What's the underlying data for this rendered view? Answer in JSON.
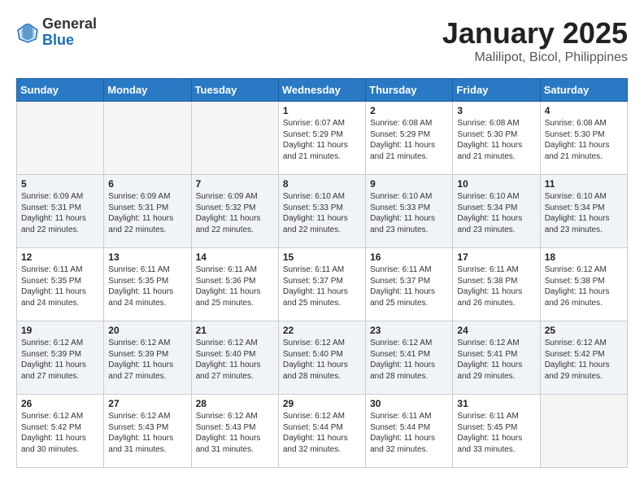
{
  "logo": {
    "general": "General",
    "blue": "Blue"
  },
  "header": {
    "title": "January 2025",
    "subtitle": "Malilipot, Bicol, Philippines"
  },
  "weekdays": [
    "Sunday",
    "Monday",
    "Tuesday",
    "Wednesday",
    "Thursday",
    "Friday",
    "Saturday"
  ],
  "weeks": [
    [
      {
        "day": "",
        "info": ""
      },
      {
        "day": "",
        "info": ""
      },
      {
        "day": "",
        "info": ""
      },
      {
        "day": "1",
        "info": "Sunrise: 6:07 AM\nSunset: 5:29 PM\nDaylight: 11 hours\nand 21 minutes."
      },
      {
        "day": "2",
        "info": "Sunrise: 6:08 AM\nSunset: 5:29 PM\nDaylight: 11 hours\nand 21 minutes."
      },
      {
        "day": "3",
        "info": "Sunrise: 6:08 AM\nSunset: 5:30 PM\nDaylight: 11 hours\nand 21 minutes."
      },
      {
        "day": "4",
        "info": "Sunrise: 6:08 AM\nSunset: 5:30 PM\nDaylight: 11 hours\nand 21 minutes."
      }
    ],
    [
      {
        "day": "5",
        "info": "Sunrise: 6:09 AM\nSunset: 5:31 PM\nDaylight: 11 hours\nand 22 minutes."
      },
      {
        "day": "6",
        "info": "Sunrise: 6:09 AM\nSunset: 5:31 PM\nDaylight: 11 hours\nand 22 minutes."
      },
      {
        "day": "7",
        "info": "Sunrise: 6:09 AM\nSunset: 5:32 PM\nDaylight: 11 hours\nand 22 minutes."
      },
      {
        "day": "8",
        "info": "Sunrise: 6:10 AM\nSunset: 5:33 PM\nDaylight: 11 hours\nand 22 minutes."
      },
      {
        "day": "9",
        "info": "Sunrise: 6:10 AM\nSunset: 5:33 PM\nDaylight: 11 hours\nand 23 minutes."
      },
      {
        "day": "10",
        "info": "Sunrise: 6:10 AM\nSunset: 5:34 PM\nDaylight: 11 hours\nand 23 minutes."
      },
      {
        "day": "11",
        "info": "Sunrise: 6:10 AM\nSunset: 5:34 PM\nDaylight: 11 hours\nand 23 minutes."
      }
    ],
    [
      {
        "day": "12",
        "info": "Sunrise: 6:11 AM\nSunset: 5:35 PM\nDaylight: 11 hours\nand 24 minutes."
      },
      {
        "day": "13",
        "info": "Sunrise: 6:11 AM\nSunset: 5:35 PM\nDaylight: 11 hours\nand 24 minutes."
      },
      {
        "day": "14",
        "info": "Sunrise: 6:11 AM\nSunset: 5:36 PM\nDaylight: 11 hours\nand 25 minutes."
      },
      {
        "day": "15",
        "info": "Sunrise: 6:11 AM\nSunset: 5:37 PM\nDaylight: 11 hours\nand 25 minutes."
      },
      {
        "day": "16",
        "info": "Sunrise: 6:11 AM\nSunset: 5:37 PM\nDaylight: 11 hours\nand 25 minutes."
      },
      {
        "day": "17",
        "info": "Sunrise: 6:11 AM\nSunset: 5:38 PM\nDaylight: 11 hours\nand 26 minutes."
      },
      {
        "day": "18",
        "info": "Sunrise: 6:12 AM\nSunset: 5:38 PM\nDaylight: 11 hours\nand 26 minutes."
      }
    ],
    [
      {
        "day": "19",
        "info": "Sunrise: 6:12 AM\nSunset: 5:39 PM\nDaylight: 11 hours\nand 27 minutes."
      },
      {
        "day": "20",
        "info": "Sunrise: 6:12 AM\nSunset: 5:39 PM\nDaylight: 11 hours\nand 27 minutes."
      },
      {
        "day": "21",
        "info": "Sunrise: 6:12 AM\nSunset: 5:40 PM\nDaylight: 11 hours\nand 27 minutes."
      },
      {
        "day": "22",
        "info": "Sunrise: 6:12 AM\nSunset: 5:40 PM\nDaylight: 11 hours\nand 28 minutes."
      },
      {
        "day": "23",
        "info": "Sunrise: 6:12 AM\nSunset: 5:41 PM\nDaylight: 11 hours\nand 28 minutes."
      },
      {
        "day": "24",
        "info": "Sunrise: 6:12 AM\nSunset: 5:41 PM\nDaylight: 11 hours\nand 29 minutes."
      },
      {
        "day": "25",
        "info": "Sunrise: 6:12 AM\nSunset: 5:42 PM\nDaylight: 11 hours\nand 29 minutes."
      }
    ],
    [
      {
        "day": "26",
        "info": "Sunrise: 6:12 AM\nSunset: 5:42 PM\nDaylight: 11 hours\nand 30 minutes."
      },
      {
        "day": "27",
        "info": "Sunrise: 6:12 AM\nSunset: 5:43 PM\nDaylight: 11 hours\nand 31 minutes."
      },
      {
        "day": "28",
        "info": "Sunrise: 6:12 AM\nSunset: 5:43 PM\nDaylight: 11 hours\nand 31 minutes."
      },
      {
        "day": "29",
        "info": "Sunrise: 6:12 AM\nSunset: 5:44 PM\nDaylight: 11 hours\nand 32 minutes."
      },
      {
        "day": "30",
        "info": "Sunrise: 6:11 AM\nSunset: 5:44 PM\nDaylight: 11 hours\nand 32 minutes."
      },
      {
        "day": "31",
        "info": "Sunrise: 6:11 AM\nSunset: 5:45 PM\nDaylight: 11 hours\nand 33 minutes."
      },
      {
        "day": "",
        "info": ""
      }
    ]
  ]
}
